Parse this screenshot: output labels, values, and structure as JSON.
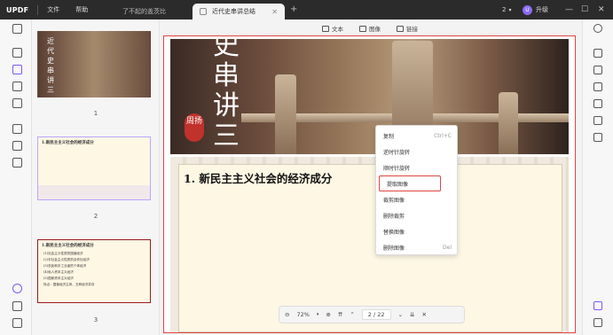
{
  "app": {
    "logo": "UPDF",
    "menu": [
      "文件",
      "帮助"
    ]
  },
  "tabs": [
    {
      "label": "了不起的盖茨比",
      "active": false
    },
    {
      "label": "近代史串讲总结",
      "active": true
    }
  ],
  "titlebar_right": {
    "count": "2",
    "upgrade": "升级",
    "avatar_initial": "U"
  },
  "toolbar": {
    "text": "文本",
    "image": "图像",
    "link": "链接"
  },
  "pages": [
    {
      "num": "1",
      "title": "近代史串讲三"
    },
    {
      "num": "2",
      "title": "1.新民主主义社会的经济成分"
    },
    {
      "num": "3",
      "title": "1.新民主主义社会的经济成分"
    }
  ],
  "thumb3_lines": [
    "(1)社会主义性质的国营经济",
    "(2)半社会主义性质的合作社经济",
    "(3)农民和手工业者的个体经济",
    "(4)私人资本主义经济",
    "(5)国家资本主义经济",
    "特点：国营经济主体，五种经济并存"
  ],
  "slide": {
    "vertical_chars": [
      "史",
      "串",
      "讲",
      "三"
    ],
    "seal": "周扬",
    "heading": "1. 新民主主义社会的经济成分"
  },
  "context_menu": [
    {
      "label": "复制",
      "shortcut": "Ctrl+C"
    },
    {
      "label": "逆时针旋转",
      "shortcut": ""
    },
    {
      "label": "顺时针旋转",
      "shortcut": ""
    },
    {
      "label": "提取图像",
      "shortcut": "",
      "highlighted": true
    },
    {
      "label": "裁剪图像",
      "shortcut": ""
    },
    {
      "label": "删除裁剪",
      "shortcut": ""
    },
    {
      "label": "替换图像",
      "shortcut": ""
    },
    {
      "label": "删除图像",
      "shortcut": "Del"
    }
  ],
  "zoom": {
    "level": "72%",
    "page_current": "2",
    "page_total": "22",
    "separator": "/"
  },
  "colors": {
    "accent": "#7a5af8",
    "highlight": "#e0453f",
    "seal": "#c0322b"
  }
}
